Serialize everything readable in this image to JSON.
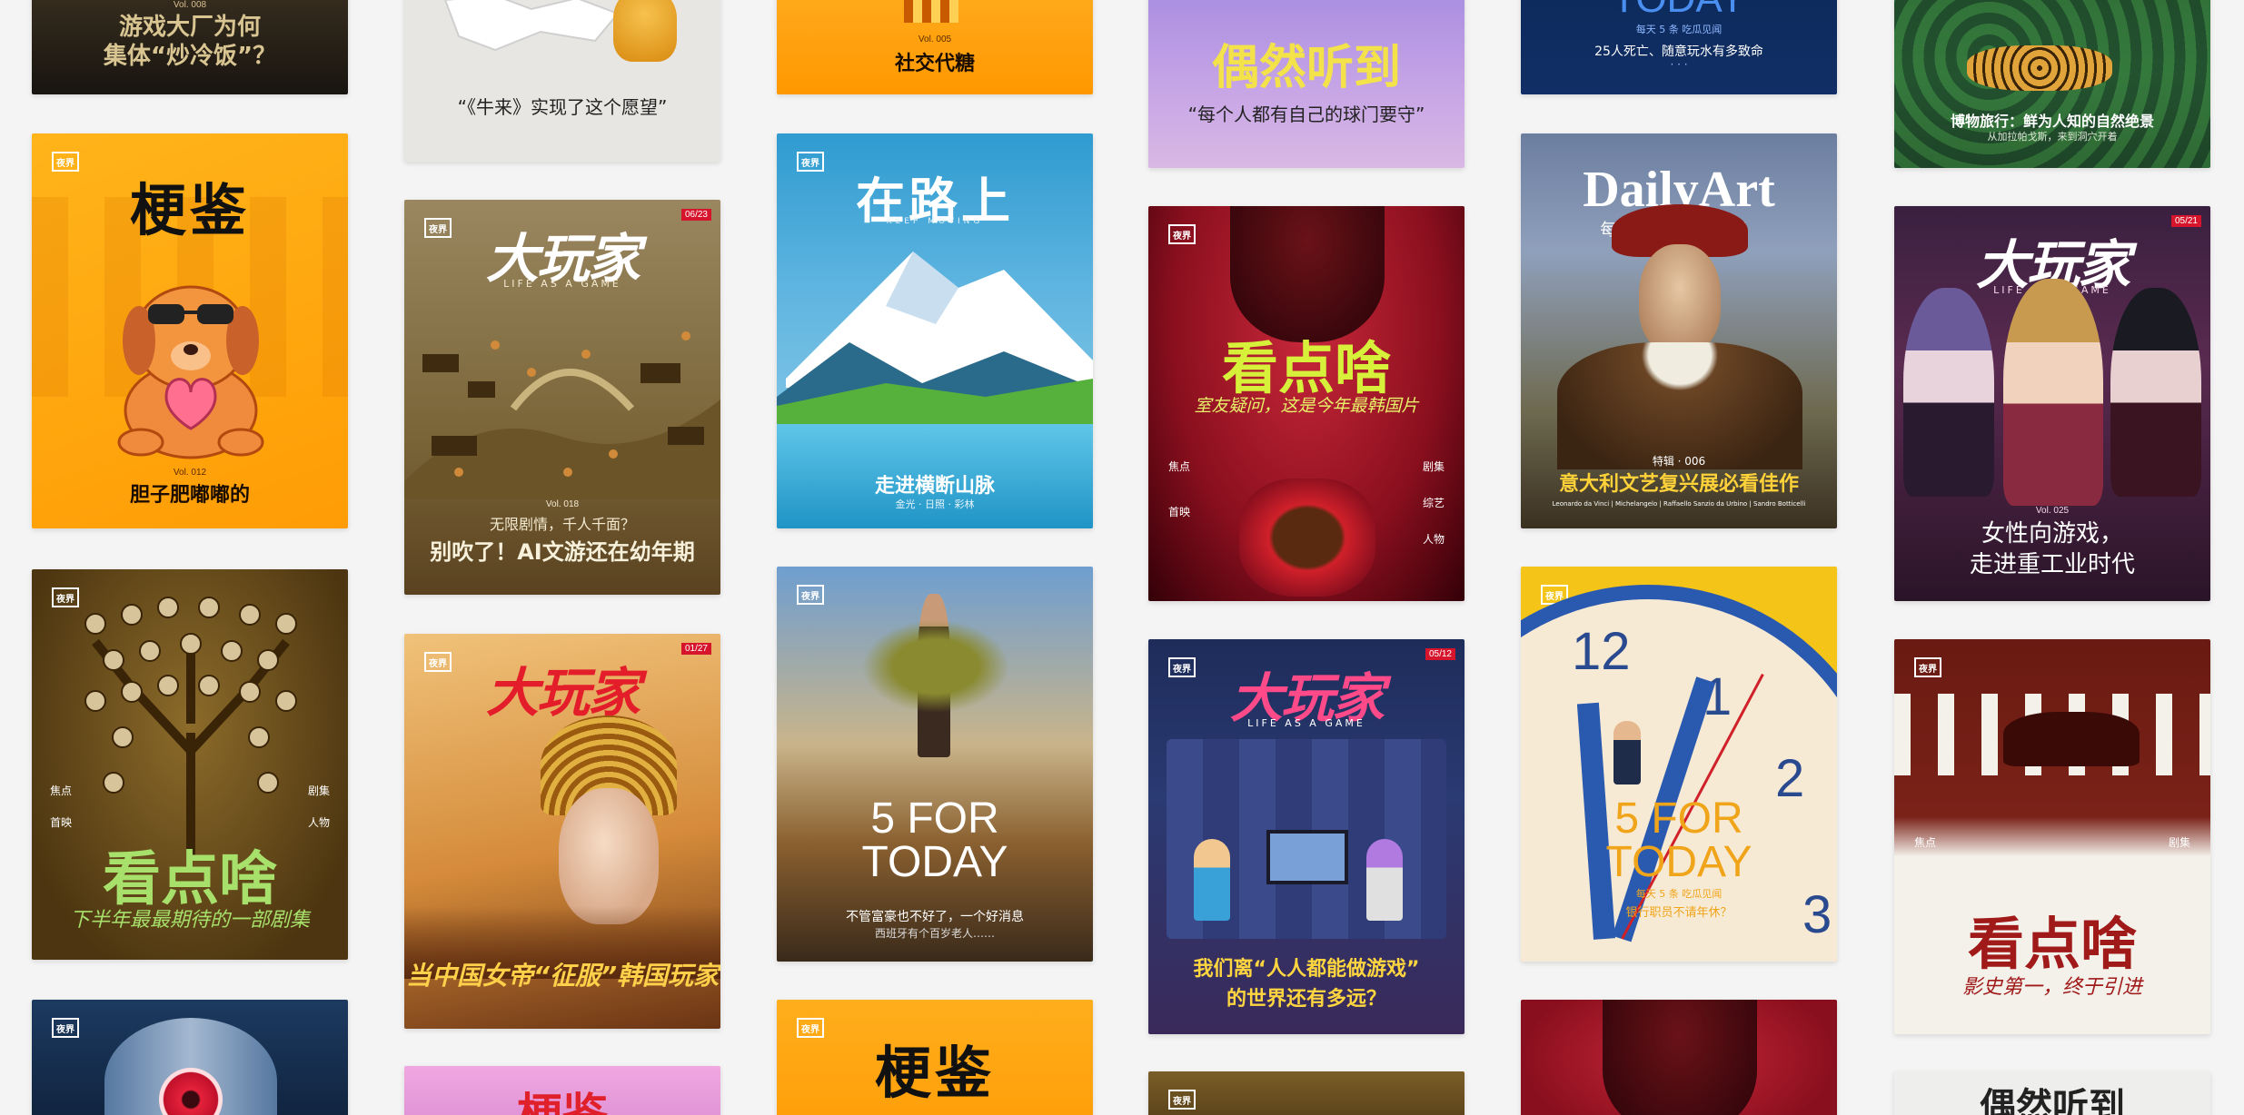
{
  "cards": {
    "c1a": {
      "vol": "Vol. 008",
      "title": "游戏大厂为何\n集体“炒冷饭”？"
    },
    "c1b": {
      "logo": "夜界",
      "title": "梗鉴",
      "vol": "Vol. 012",
      "subtitle": "胆子肥嘟嘟的"
    },
    "c1c": {
      "logo": "夜界",
      "brand": "看点啥",
      "left1": "焦点",
      "left2": "首映",
      "right1": "剧集",
      "right2": "人物",
      "subtitle": "下半年最最期待的一部剧集"
    },
    "c1d": {
      "logo": "夜界"
    },
    "c2a": {
      "title": "“《牛来》实现了这个愿望”"
    },
    "c2b": {
      "logo": "夜界",
      "brand": "大玩家",
      "tagline": "LIFE AS A GAME",
      "issue": "06/23",
      "vol": "Vol. 018",
      "line1": "无限剧情，千人千面？",
      "line2": "别吹了！AI文游还在幼年期"
    },
    "c2c": {
      "logo": "夜界",
      "brand": "大玩家",
      "issue": "01/27",
      "subtitle": "当中国女帝“征服”韩国玩家"
    },
    "c2d": {
      "title": "梗鉴"
    },
    "c3a": {
      "vol": "Vol. 005",
      "title": "社交代糖"
    },
    "c3b": {
      "logo": "夜界",
      "title": "在路上",
      "sub": "KEEP MOVING",
      "line1": "走进横断山脉",
      "line2": "金光 · 日照 · 彩林"
    },
    "c3c": {
      "logo": "夜界",
      "brand1": "5 FOR",
      "brand2": "TODAY",
      "line1": "不管富豪也不好了，一个好消息",
      "line2": "西班牙有个百岁老人……"
    },
    "c3d": {
      "logo": "夜界",
      "title": "梗鉴"
    },
    "c4a": {
      "title": "偶然听到",
      "subtitle": "“每个人都有自己的球门要守”"
    },
    "c4b": {
      "logo": "夜界",
      "brand": "看点啥",
      "subtitle": "室友疑问，这是今年最韩国片",
      "left1": "焦点",
      "left2": "首映",
      "right1": "剧集",
      "right2": "综艺",
      "right3": "人物"
    },
    "c4c": {
      "logo": "夜界",
      "brand": "大玩家",
      "tagline": "LIFE AS A GAME",
      "issue": "05/12",
      "line1": "我们离“人人都能做游戏”",
      "line2": "的世界还有多远？"
    },
    "c4d": {
      "logo": "夜界"
    },
    "c5a": {
      "brand": "TODAY",
      "sub": "每天 5 条  吃瓜见闻",
      "line1": "25人死亡、随意玩水有多致命",
      "line2": "· · ·"
    },
    "c5b": {
      "brand": "DailyArt",
      "sub": "每 日 一 画",
      "tag": "特辑 · 006",
      "title": "意大利文艺复兴展必看佳作",
      "names": "Leonardo da Vinci | Michelangelo | Raffaello Sanzio da Urbino | Sandro Botticelli"
    },
    "c5c": {
      "logo": "夜界",
      "brand1": "5 FOR",
      "brand2": "TODAY",
      "sub": "每天 5 条  吃瓜见闻",
      "line1": "银行职员不请年休？",
      "num12": "12",
      "num1": "1",
      "num2": "2",
      "num3": "3"
    },
    "c5d": {},
    "c6a": {
      "title": "博物旅行：鲜为人知的自然绝景",
      "sub": "从加拉帕戈斯，来到洞穴开着"
    },
    "c6b": {
      "brand": "大玩家",
      "tagline": "LIFE AS A GAME",
      "issue": "05/21",
      "vol": "Vol. 025",
      "line1": "女性向游戏，",
      "line2": "走进重工业时代"
    },
    "c6c": {
      "logo": "夜界",
      "brand": "看点啥",
      "left1": "焦点",
      "right1": "剧集",
      "subtitle": "影史第一，终于引进"
    },
    "c6d": {
      "title": "偶然听到"
    }
  }
}
